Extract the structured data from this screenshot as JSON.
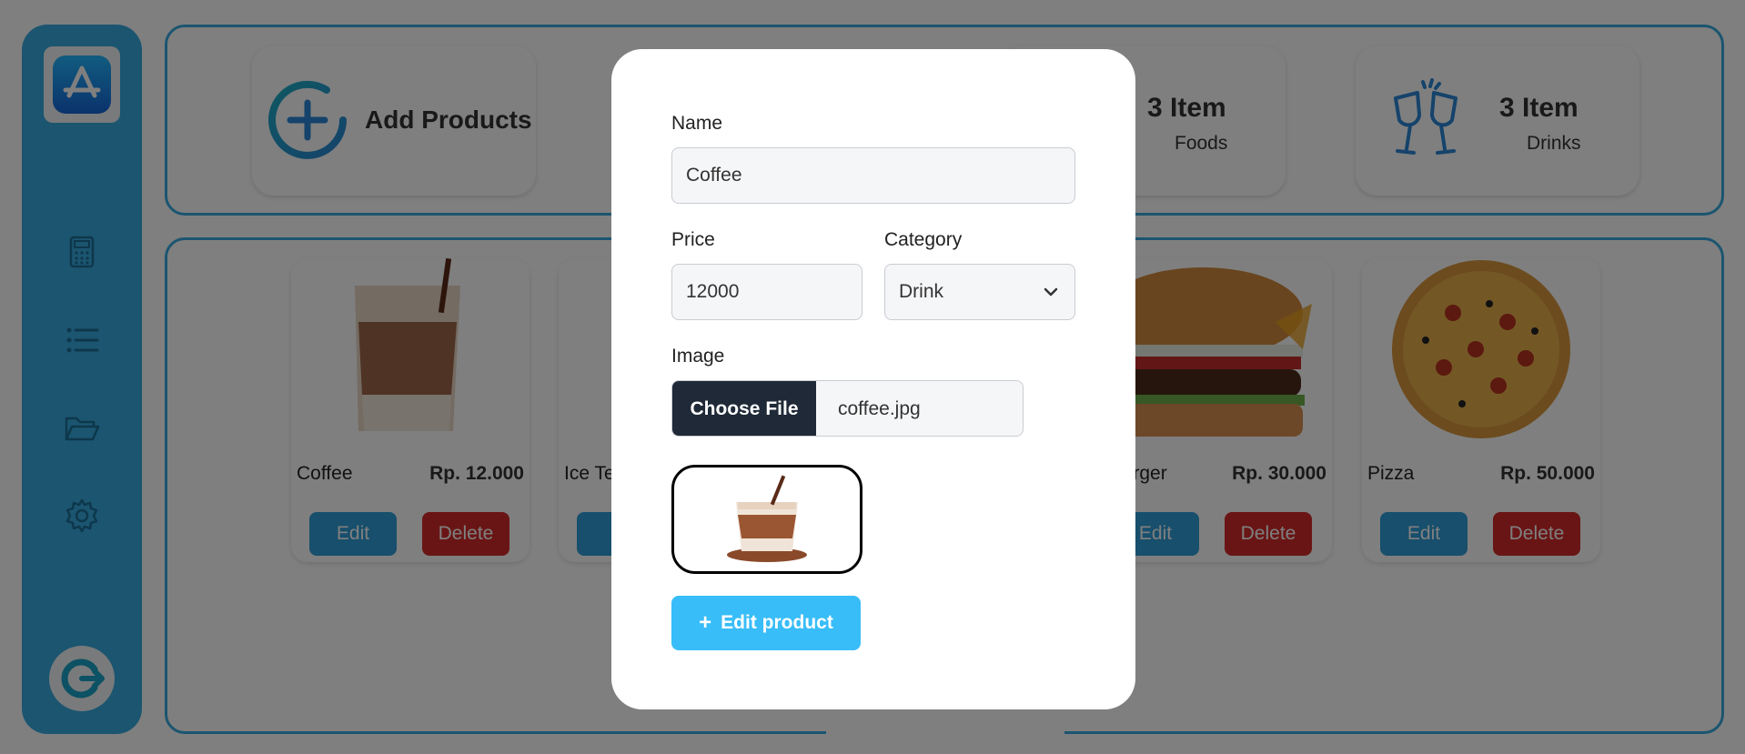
{
  "stats": {
    "add_products_label": "Add Products",
    "foods": {
      "count": "3 Item",
      "label": "Foods"
    },
    "drinks": {
      "count": "3 Item",
      "label": "Drinks"
    }
  },
  "products": [
    {
      "name": "Coffee",
      "price": "Rp. 12.000",
      "edit": "Edit",
      "delete": "Delete"
    },
    {
      "name": "Ice Te",
      "price": "",
      "edit": "E",
      "delete": ""
    },
    {
      "name": "f Burger",
      "price": "Rp. 30.000",
      "edit": "Edit",
      "delete": "Delete"
    },
    {
      "name": "Pizza",
      "price": "Rp. 50.000",
      "edit": "Edit",
      "delete": "Delete"
    }
  ],
  "modal": {
    "name_label": "Name",
    "name_value": "Coffee",
    "price_label": "Price",
    "price_value": "12000",
    "category_label": "Category",
    "category_value": "Drink",
    "image_label": "Image",
    "choose_file_label": "Choose File",
    "file_name": "coffee.jpg",
    "submit_label": "Edit product",
    "submit_icon": "+"
  },
  "colors": {
    "accent": "#36abe0",
    "delete": "#d52b2b",
    "submit": "#38bdf8",
    "dark": "#1f2937"
  },
  "icons": [
    "app-store-icon",
    "calculator-icon",
    "list-icon",
    "folder-icon",
    "gear-icon",
    "logout-icon",
    "add-circle-icon",
    "cheers-icon",
    "chevron-down-icon",
    "plus-icon"
  ]
}
